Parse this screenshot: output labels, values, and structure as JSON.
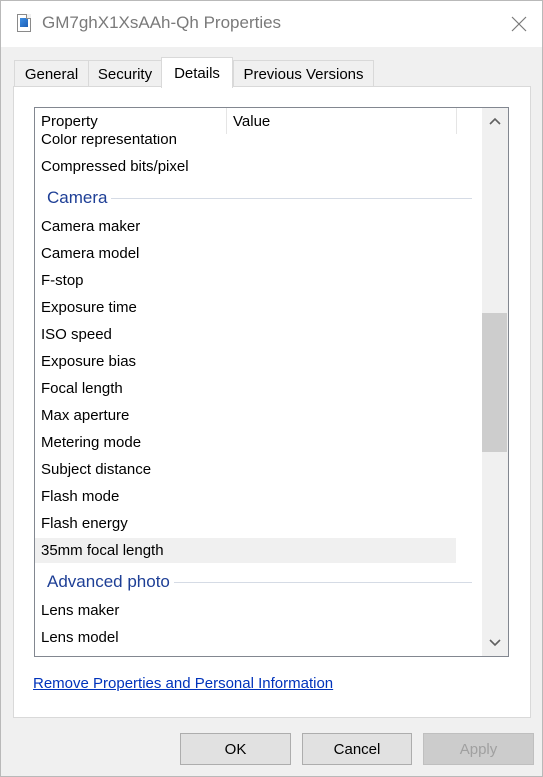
{
  "window": {
    "title": "GM7ghX1XsAAh-Qh Properties"
  },
  "tabs": [
    {
      "label": "General"
    },
    {
      "label": "Security"
    },
    {
      "label": "Details"
    },
    {
      "label": "Previous Versions"
    }
  ],
  "active_tab": "Details",
  "list": {
    "columns": [
      "Property",
      "Value"
    ],
    "rows": [
      {
        "kind": "item",
        "label": "Color representation"
      },
      {
        "kind": "item",
        "label": "Compressed bits/pixel"
      },
      {
        "kind": "group",
        "label": "Camera"
      },
      {
        "kind": "item",
        "label": "Camera maker"
      },
      {
        "kind": "item",
        "label": "Camera model"
      },
      {
        "kind": "item",
        "label": "F-stop"
      },
      {
        "kind": "item",
        "label": "Exposure time"
      },
      {
        "kind": "item",
        "label": "ISO speed"
      },
      {
        "kind": "item",
        "label": "Exposure bias"
      },
      {
        "kind": "item",
        "label": "Focal length"
      },
      {
        "kind": "item",
        "label": "Max aperture"
      },
      {
        "kind": "item",
        "label": "Metering mode"
      },
      {
        "kind": "item",
        "label": "Subject distance"
      },
      {
        "kind": "item",
        "label": "Flash mode"
      },
      {
        "kind": "item",
        "label": "Flash energy"
      },
      {
        "kind": "item",
        "label": "35mm focal length",
        "selected": true
      },
      {
        "kind": "group",
        "label": "Advanced photo"
      },
      {
        "kind": "item",
        "label": "Lens maker"
      },
      {
        "kind": "item",
        "label": "Lens model"
      }
    ],
    "scroll_position": 0.5,
    "scroll_visible_fraction": 0.28
  },
  "links": {
    "remove": "Remove Properties and Personal Information"
  },
  "buttons": {
    "ok": "OK",
    "cancel": "Cancel",
    "apply": "Apply"
  },
  "icons": {
    "title": "image-file-icon",
    "close": "close-icon",
    "scroll_up": "chevron-up-icon",
    "scroll_down": "chevron-down-icon"
  },
  "colors": {
    "group_header": "#1e3f96",
    "link": "#0033bb",
    "selection": "#f0f0f0"
  }
}
